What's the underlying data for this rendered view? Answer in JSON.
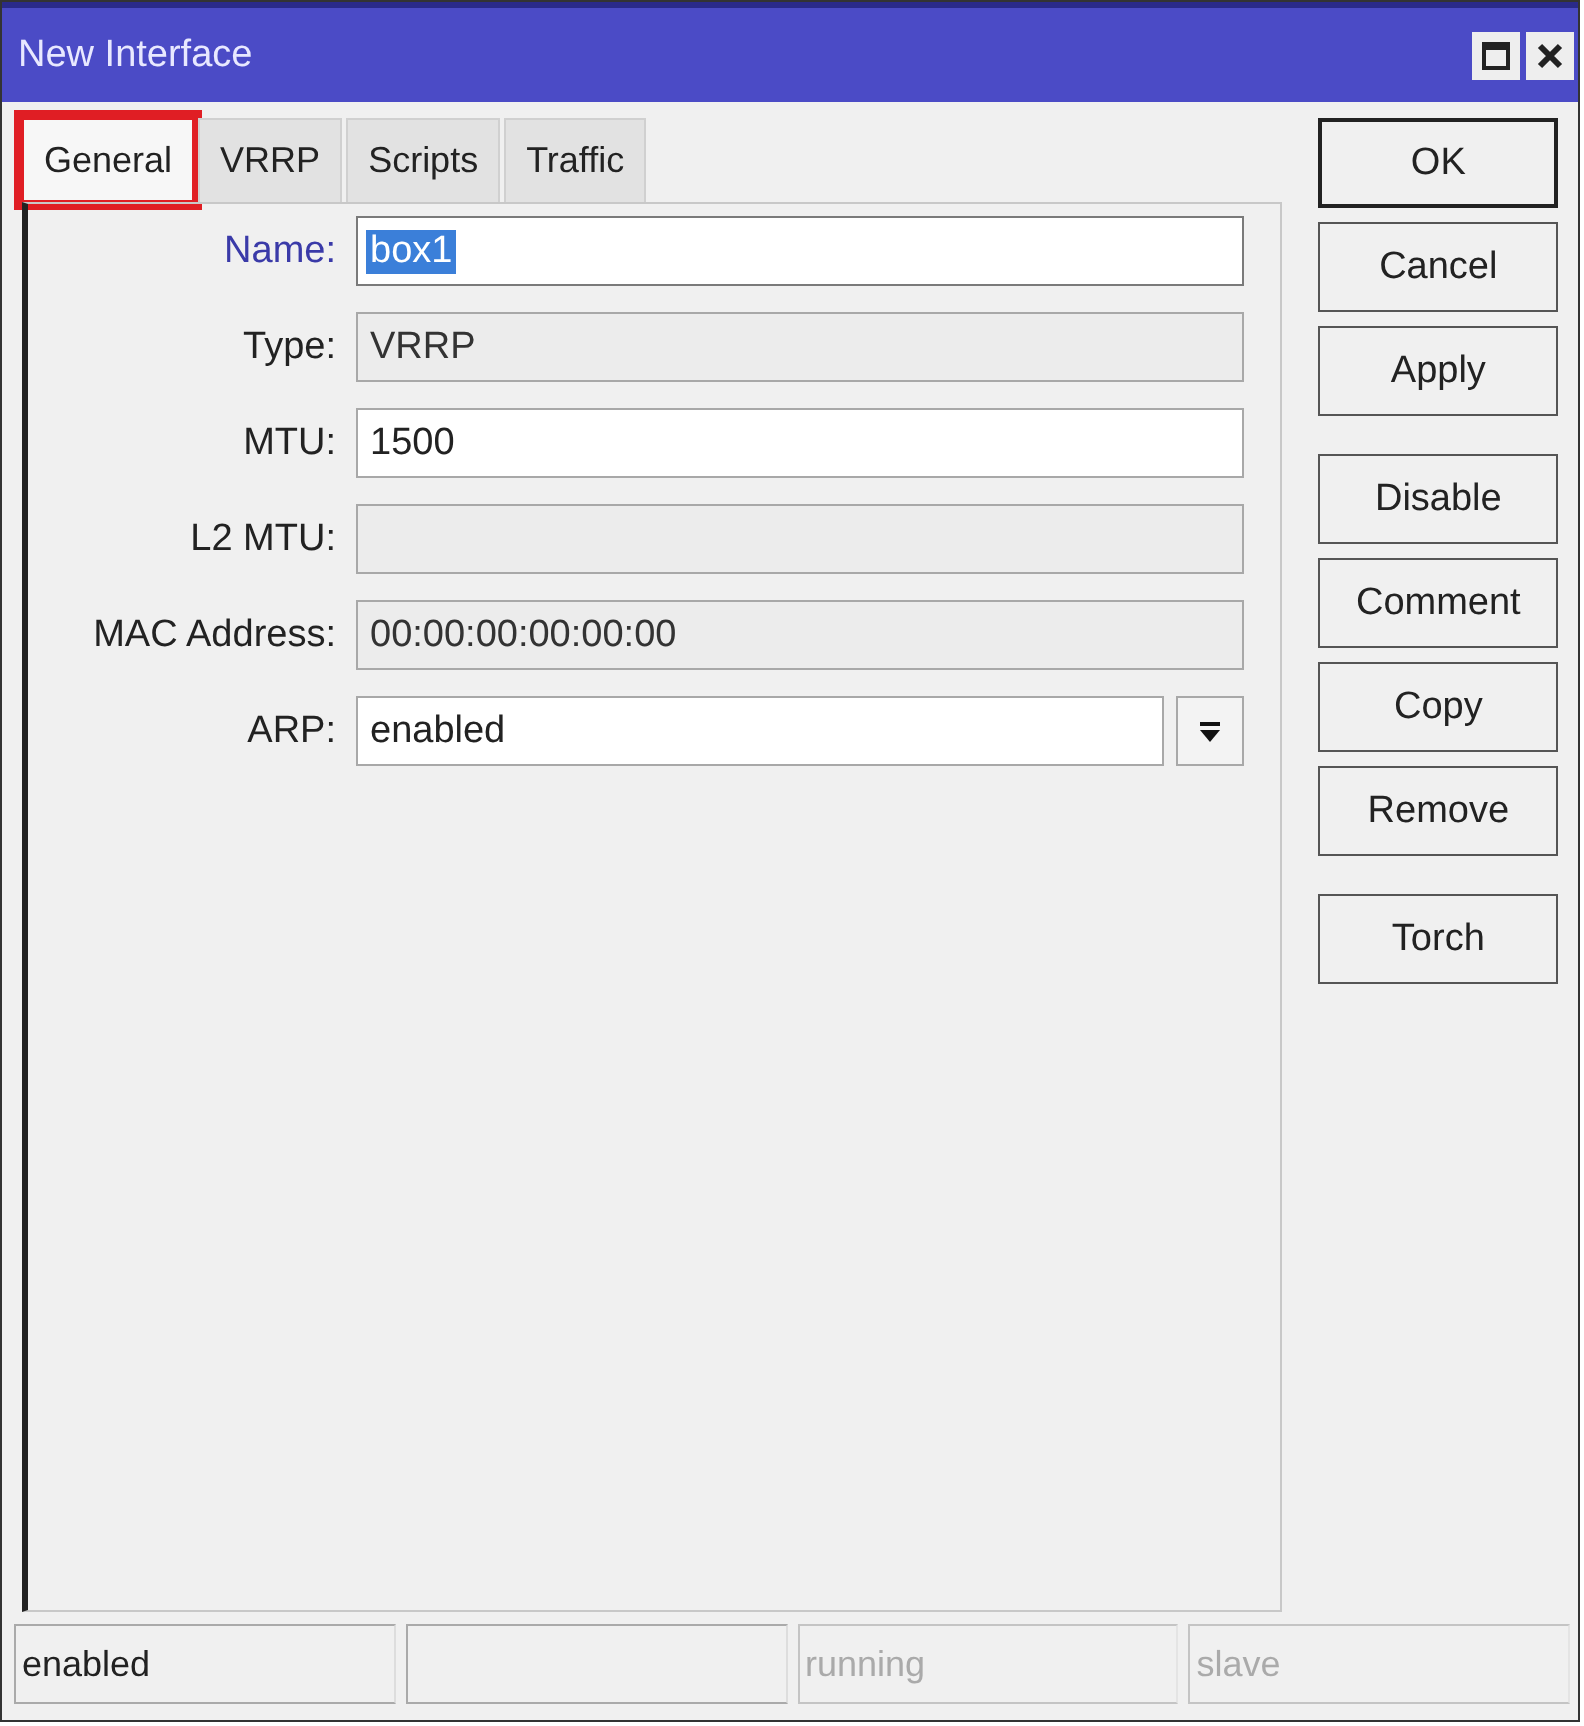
{
  "window": {
    "title": "New Interface"
  },
  "tabs": [
    {
      "label": "General",
      "selected": true,
      "highlighted": true
    },
    {
      "label": "VRRP",
      "selected": false,
      "highlighted": false
    },
    {
      "label": "Scripts",
      "selected": false,
      "highlighted": false
    },
    {
      "label": "Traffic",
      "selected": false,
      "highlighted": false
    }
  ],
  "fields": [
    {
      "label": "Name:",
      "value": "box1",
      "kind": "text",
      "disabled": false,
      "focused": true,
      "text_selected": true
    },
    {
      "label": "Type:",
      "value": "VRRP",
      "kind": "text",
      "disabled": true,
      "focused": false,
      "text_selected": false
    },
    {
      "label": "MTU:",
      "value": "1500",
      "kind": "text",
      "disabled": false,
      "focused": false,
      "text_selected": false
    },
    {
      "label": "L2 MTU:",
      "kind": "text",
      "disabled": true,
      "focused": false,
      "text_selected": false
    },
    {
      "label": "MAC Address:",
      "value": "00:00:00:00:00:00",
      "kind": "text",
      "disabled": true,
      "focused": false,
      "text_selected": false
    },
    {
      "label": "ARP:",
      "value": "enabled",
      "kind": "dropdown",
      "disabled": false,
      "focused": false,
      "text_selected": false
    }
  ],
  "button_groups": [
    [
      {
        "label": "OK",
        "default": true
      },
      {
        "label": "Cancel",
        "default": false
      },
      {
        "label": "Apply",
        "default": false
      }
    ],
    [
      {
        "label": "Disable",
        "default": false
      },
      {
        "label": "Comment",
        "default": false
      },
      {
        "label": "Copy",
        "default": false
      },
      {
        "label": "Remove",
        "default": false
      }
    ],
    [
      {
        "label": "Torch",
        "default": false
      }
    ]
  ],
  "status_bar": [
    {
      "text": "enabled",
      "disabled": false
    },
    {
      "disabled": false
    },
    {
      "text": "running",
      "disabled": true
    },
    {
      "text": "slave",
      "disabled": true
    }
  ]
}
